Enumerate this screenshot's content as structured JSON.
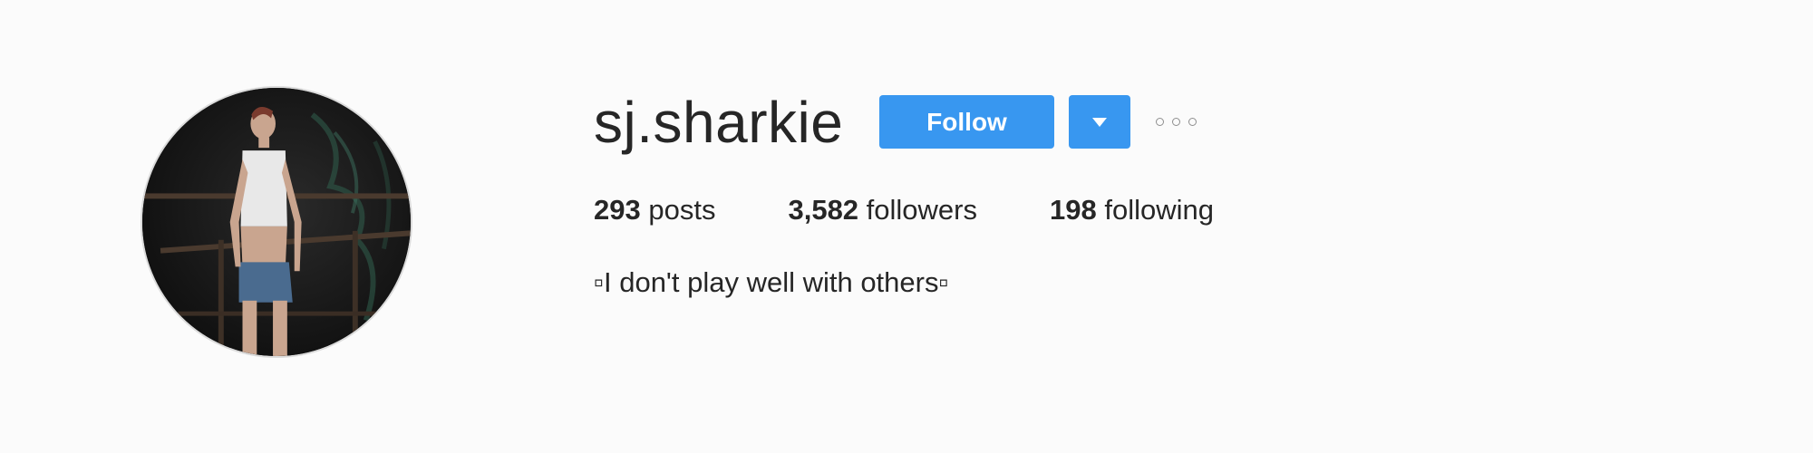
{
  "profile": {
    "username": "sj.sharkie",
    "bio": "▫I don't play well with others▫"
  },
  "actions": {
    "follow_label": "Follow",
    "dropdown_icon": "caret-down-icon",
    "more_icon": "more-options-icon"
  },
  "stats": {
    "posts": {
      "count": "293",
      "label": "posts"
    },
    "followers": {
      "count": "3,582",
      "label": "followers"
    },
    "following": {
      "count": "198",
      "label": "following"
    }
  },
  "colors": {
    "accent": "#3897f0",
    "background": "#fbfbfb",
    "text": "#262626"
  }
}
